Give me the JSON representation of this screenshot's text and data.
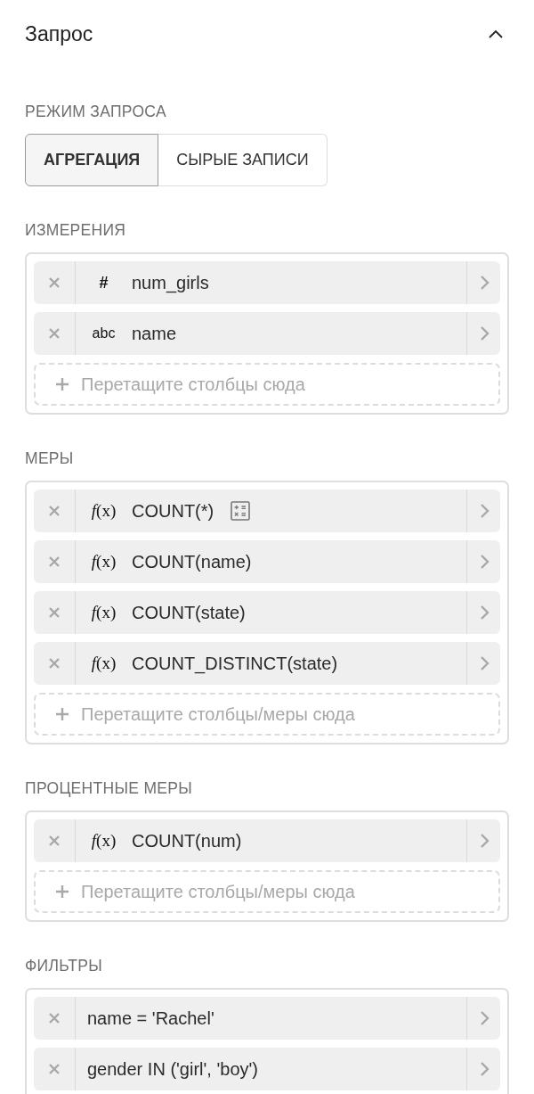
{
  "panel": {
    "title": "Запрос",
    "expanded": true
  },
  "query_mode": {
    "label": "РЕЖИМ ЗАПРОСА",
    "options": [
      {
        "label": "АГРЕГАЦИЯ",
        "selected": true
      },
      {
        "label": "СЫРЫЕ ЗАПИСИ",
        "selected": false
      }
    ]
  },
  "sections": [
    {
      "label": "ИЗМЕРЕНИЯ",
      "items": [
        {
          "kind": "numeric",
          "type_text": "#",
          "text": "num_girls"
        },
        {
          "kind": "string",
          "type_text": "abc",
          "text": "name"
        }
      ],
      "dropzone": "Перетащите столбцы сюда"
    },
    {
      "label": "МЕРЫ",
      "items": [
        {
          "kind": "function",
          "type_text": "*f*(x)",
          "text": "COUNT(*)",
          "expression_icon": true
        },
        {
          "kind": "function",
          "type_text": "*f*(x)",
          "text": "COUNT(name)"
        },
        {
          "kind": "function",
          "type_text": "*f*(x)",
          "text": "COUNT(state)"
        },
        {
          "kind": "function",
          "type_text": "*f*(x)",
          "text": "COUNT_DISTINCT(state)"
        }
      ],
      "dropzone": "Перетащите столбцы/меры сюда"
    },
    {
      "label": "ПРОЦЕНТНЫЕ МЕРЫ",
      "items": [
        {
          "kind": "function",
          "type_text": "*f*(x)",
          "text": "COUNT(num)"
        }
      ],
      "dropzone": "Перетащите столбцы/меры сюда"
    },
    {
      "label": "ФИЛЬТРЫ",
      "items": [
        {
          "kind": "filter",
          "text": "name = 'Rachel'"
        },
        {
          "kind": "filter",
          "text": "gender IN ('girl', 'boy')"
        }
      ]
    }
  ]
}
